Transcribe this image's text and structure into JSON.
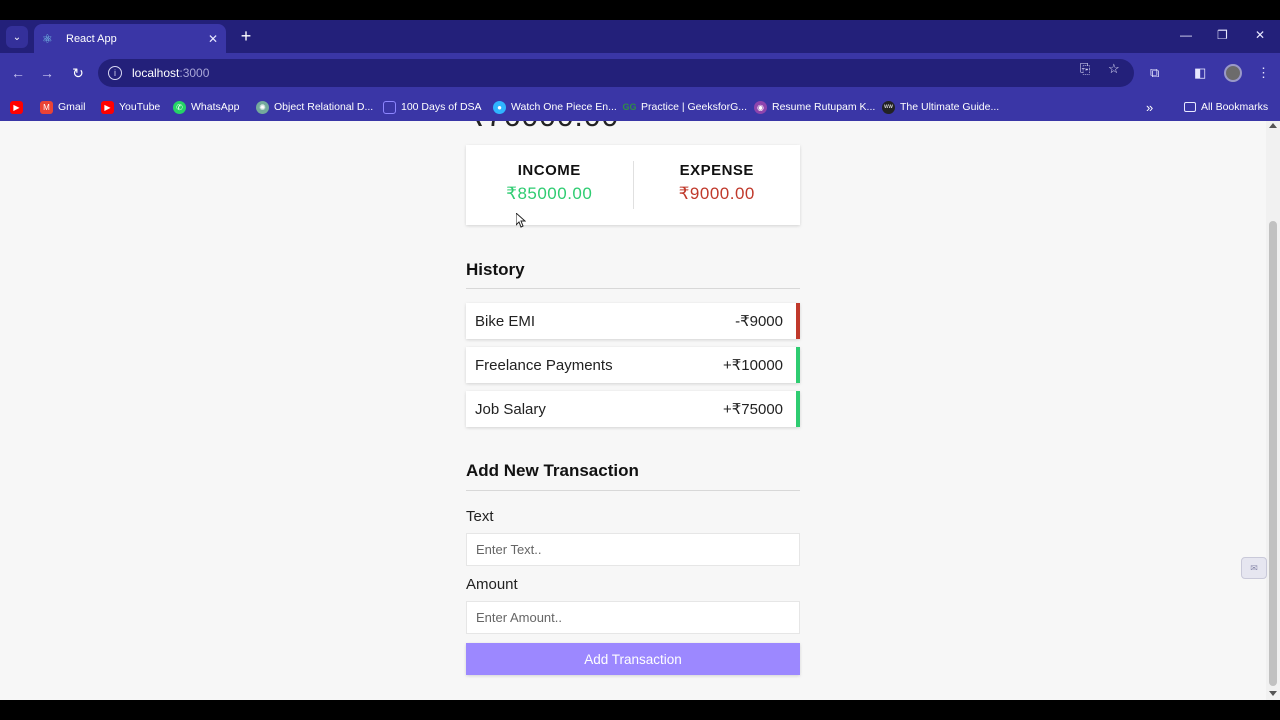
{
  "browser": {
    "tab_title": "React App",
    "tab_favicon": "react-icon",
    "new_tab_label": "+",
    "url_host": "localhost",
    "url_port": ":3000",
    "bookmarks": [
      {
        "label": "",
        "icon": "youtube-icon",
        "color": "#ff0000"
      },
      {
        "label": "Gmail",
        "icon": "gmail-icon",
        "color": "#ea4335"
      },
      {
        "label": "YouTube",
        "icon": "youtube-icon",
        "color": "#ff0000"
      },
      {
        "label": "WhatsApp",
        "icon": "whatsapp-icon",
        "color": "#25d366"
      },
      {
        "label": "Object Relational D...",
        "icon": "chatgpt-icon",
        "color": "#74aa9c"
      },
      {
        "label": "100 Days of DSA",
        "icon": "calendar-icon",
        "color": "#6c63ff"
      },
      {
        "label": "Watch One Piece En...",
        "icon": "play-icon",
        "color": "#2fb5ff"
      },
      {
        "label": "Practice | GeeksforG...",
        "icon": "geeksforgeeks-icon",
        "color": "#2f8d46"
      },
      {
        "label": "Resume Rutupam K...",
        "icon": "resume-icon",
        "color": "#8e44ad"
      },
      {
        "label": "The Ultimate Guide...",
        "icon": "ww-icon",
        "color": "#222222"
      }
    ],
    "all_bookmarks_label": "All Bookmarks"
  },
  "summary": {
    "income_label": "INCOME",
    "income_value": "₹85000.00",
    "expense_label": "EXPENSE",
    "expense_value": "₹9000.00"
  },
  "history": {
    "title": "History",
    "items": [
      {
        "text": "Bike EMI",
        "amount": "-₹9000",
        "type": "minus"
      },
      {
        "text": "Freelance Payments",
        "amount": "+₹10000",
        "type": "plus"
      },
      {
        "text": "Job Salary",
        "amount": "+₹75000",
        "type": "plus"
      }
    ]
  },
  "form": {
    "title": "Add New Transaction",
    "text_label": "Text",
    "text_placeholder": "Enter Text..",
    "amount_label": "Amount",
    "amount_placeholder": "Enter Amount..",
    "submit_label": "Add Transaction"
  },
  "colors": {
    "income": "#2ecc71",
    "expense": "#c0392b",
    "button": "#9c88ff",
    "chrome": "#3a36a6"
  }
}
